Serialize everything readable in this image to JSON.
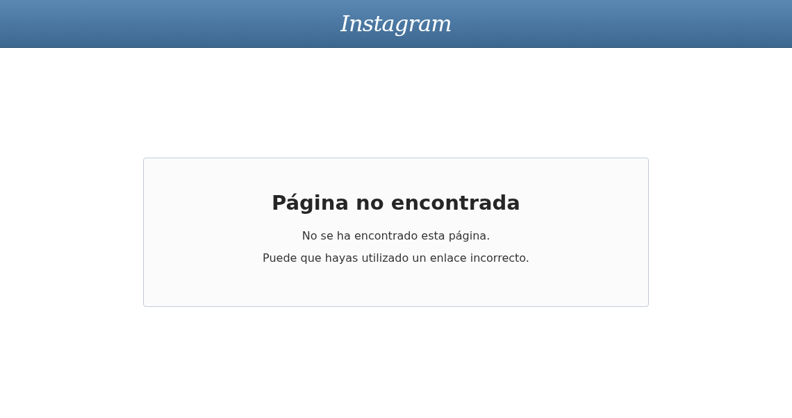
{
  "header": {
    "logo": "Instagram"
  },
  "error_card": {
    "title": "Página no encontrada",
    "lines": [
      "No se ha encontrado esta página.",
      "Puede que hayas utilizado un enlace incorrecto."
    ]
  }
}
